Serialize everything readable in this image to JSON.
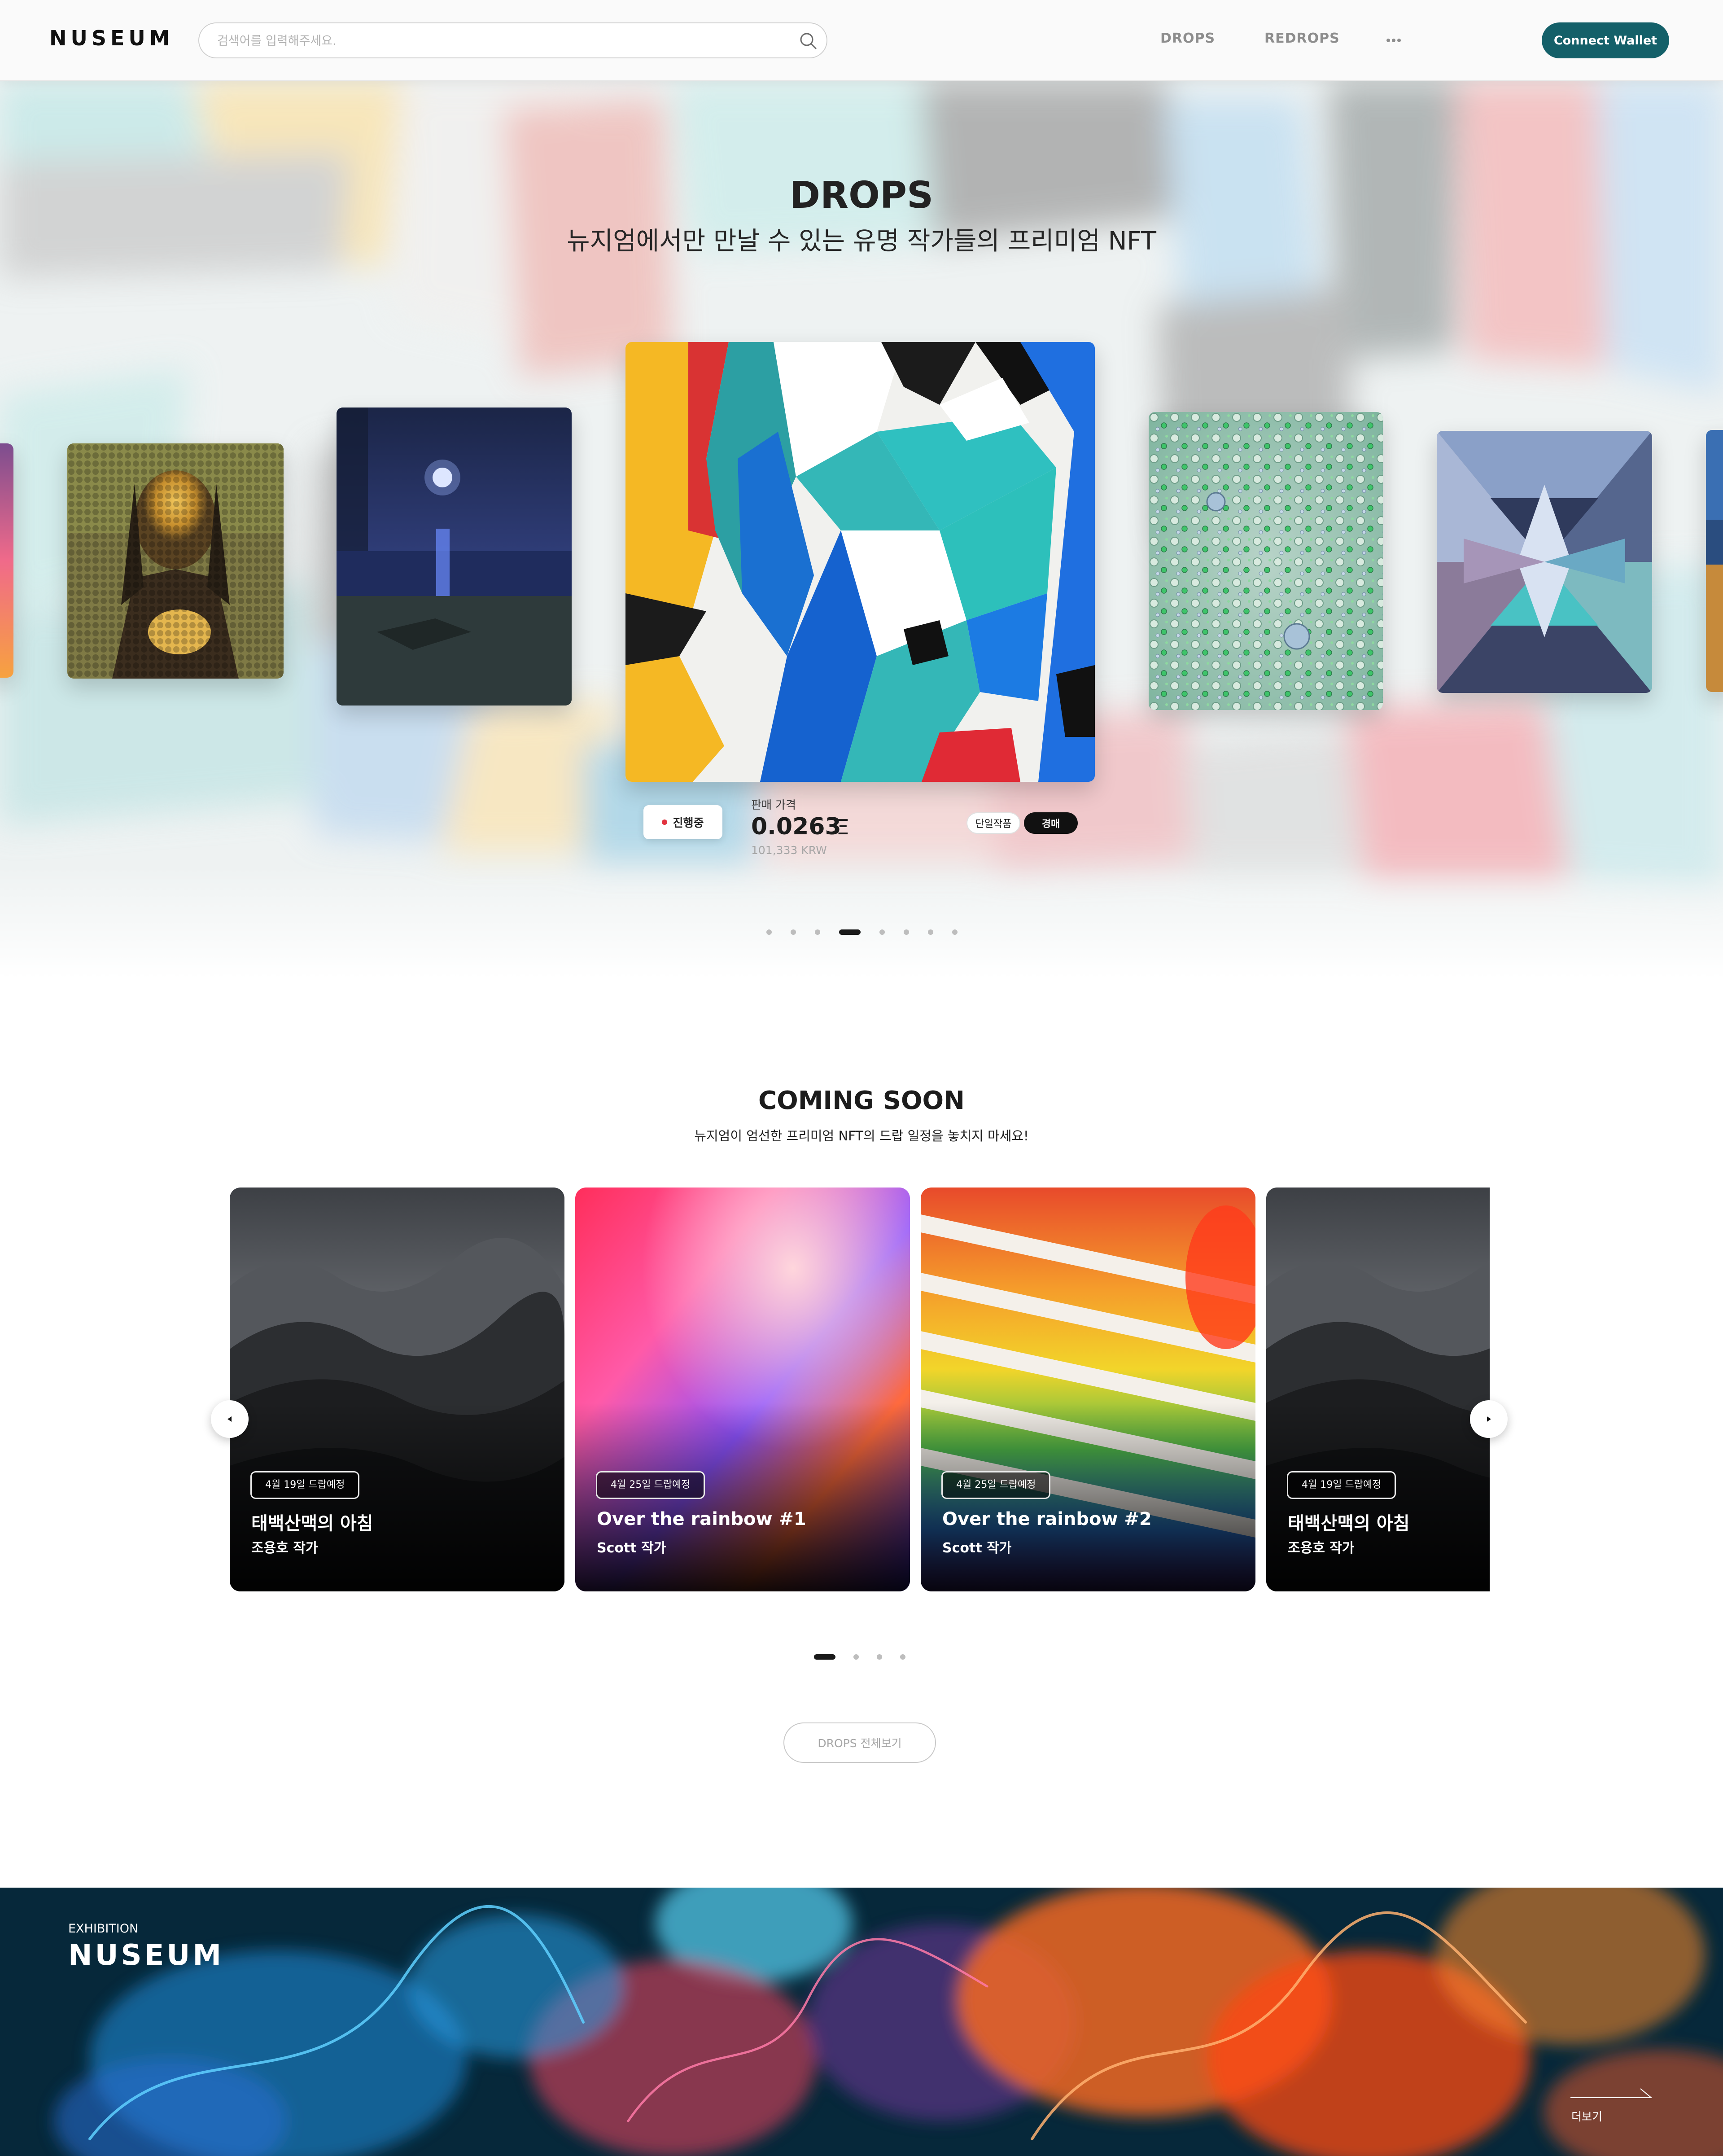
{
  "header": {
    "logo": "NUSEUM",
    "search_placeholder": "검색어를 입력해주세요.",
    "nav": {
      "drops": "DROPS",
      "redrops": "REDROPS"
    },
    "wallet_button": "Connect Wallet",
    "brand_color": "#146069"
  },
  "hero": {
    "title": "DROPS",
    "subtitle": "뉴지엄에서만 만날 수 있는 유명 작가들의 프리미엄 NFT",
    "featured": {
      "status": "진행중",
      "price_label": "판매 가격",
      "price": "0.0263",
      "currency_symbol": "Ξ",
      "price_krw": "101,333 KRW",
      "tags": [
        "단일작품",
        "경매"
      ]
    },
    "slides": [
      {
        "icon": "sunset-artwork-thumbnail"
      },
      {
        "icon": "pixel-mona-lisa-artwork"
      },
      {
        "icon": "moonlit-sea-artwork"
      },
      {
        "icon": "abstract-painted-wall-artwork"
      },
      {
        "icon": "green-bubbles-artwork"
      },
      {
        "icon": "crystal-prism-artwork"
      },
      {
        "icon": "landscape-artwork-thumbnail"
      }
    ],
    "pagination": {
      "count": 8,
      "active_index": 3
    }
  },
  "coming_soon": {
    "title": "COMING SOON",
    "subtitle": "뉴지엄이 엄선한 프리미엄 NFT의 드랍 일정을 놓치지 마세요!",
    "cards": [
      {
        "date": "4월 19일 드랍예정",
        "title": "태백산맥의 아침",
        "artist": "조용호 작가"
      },
      {
        "date": "4월 25일 드랍예정",
        "title": "Over the rainbow #1",
        "artist": "Scott 작가"
      },
      {
        "date": "4월 25일 드랍예정",
        "title": "Over the rainbow #2",
        "artist": "Scott 작가"
      },
      {
        "date": "4월 19일 드랍예정",
        "title": "태백산맥의 아침",
        "artist": "조용호 작가"
      }
    ],
    "pagination": {
      "count": 4,
      "active_index": 0
    },
    "view_all_button": "DROPS 전체보기"
  },
  "exhibition": {
    "label": "EXHIBITION",
    "logo": "NUSEUM",
    "more_link": "더보기"
  }
}
